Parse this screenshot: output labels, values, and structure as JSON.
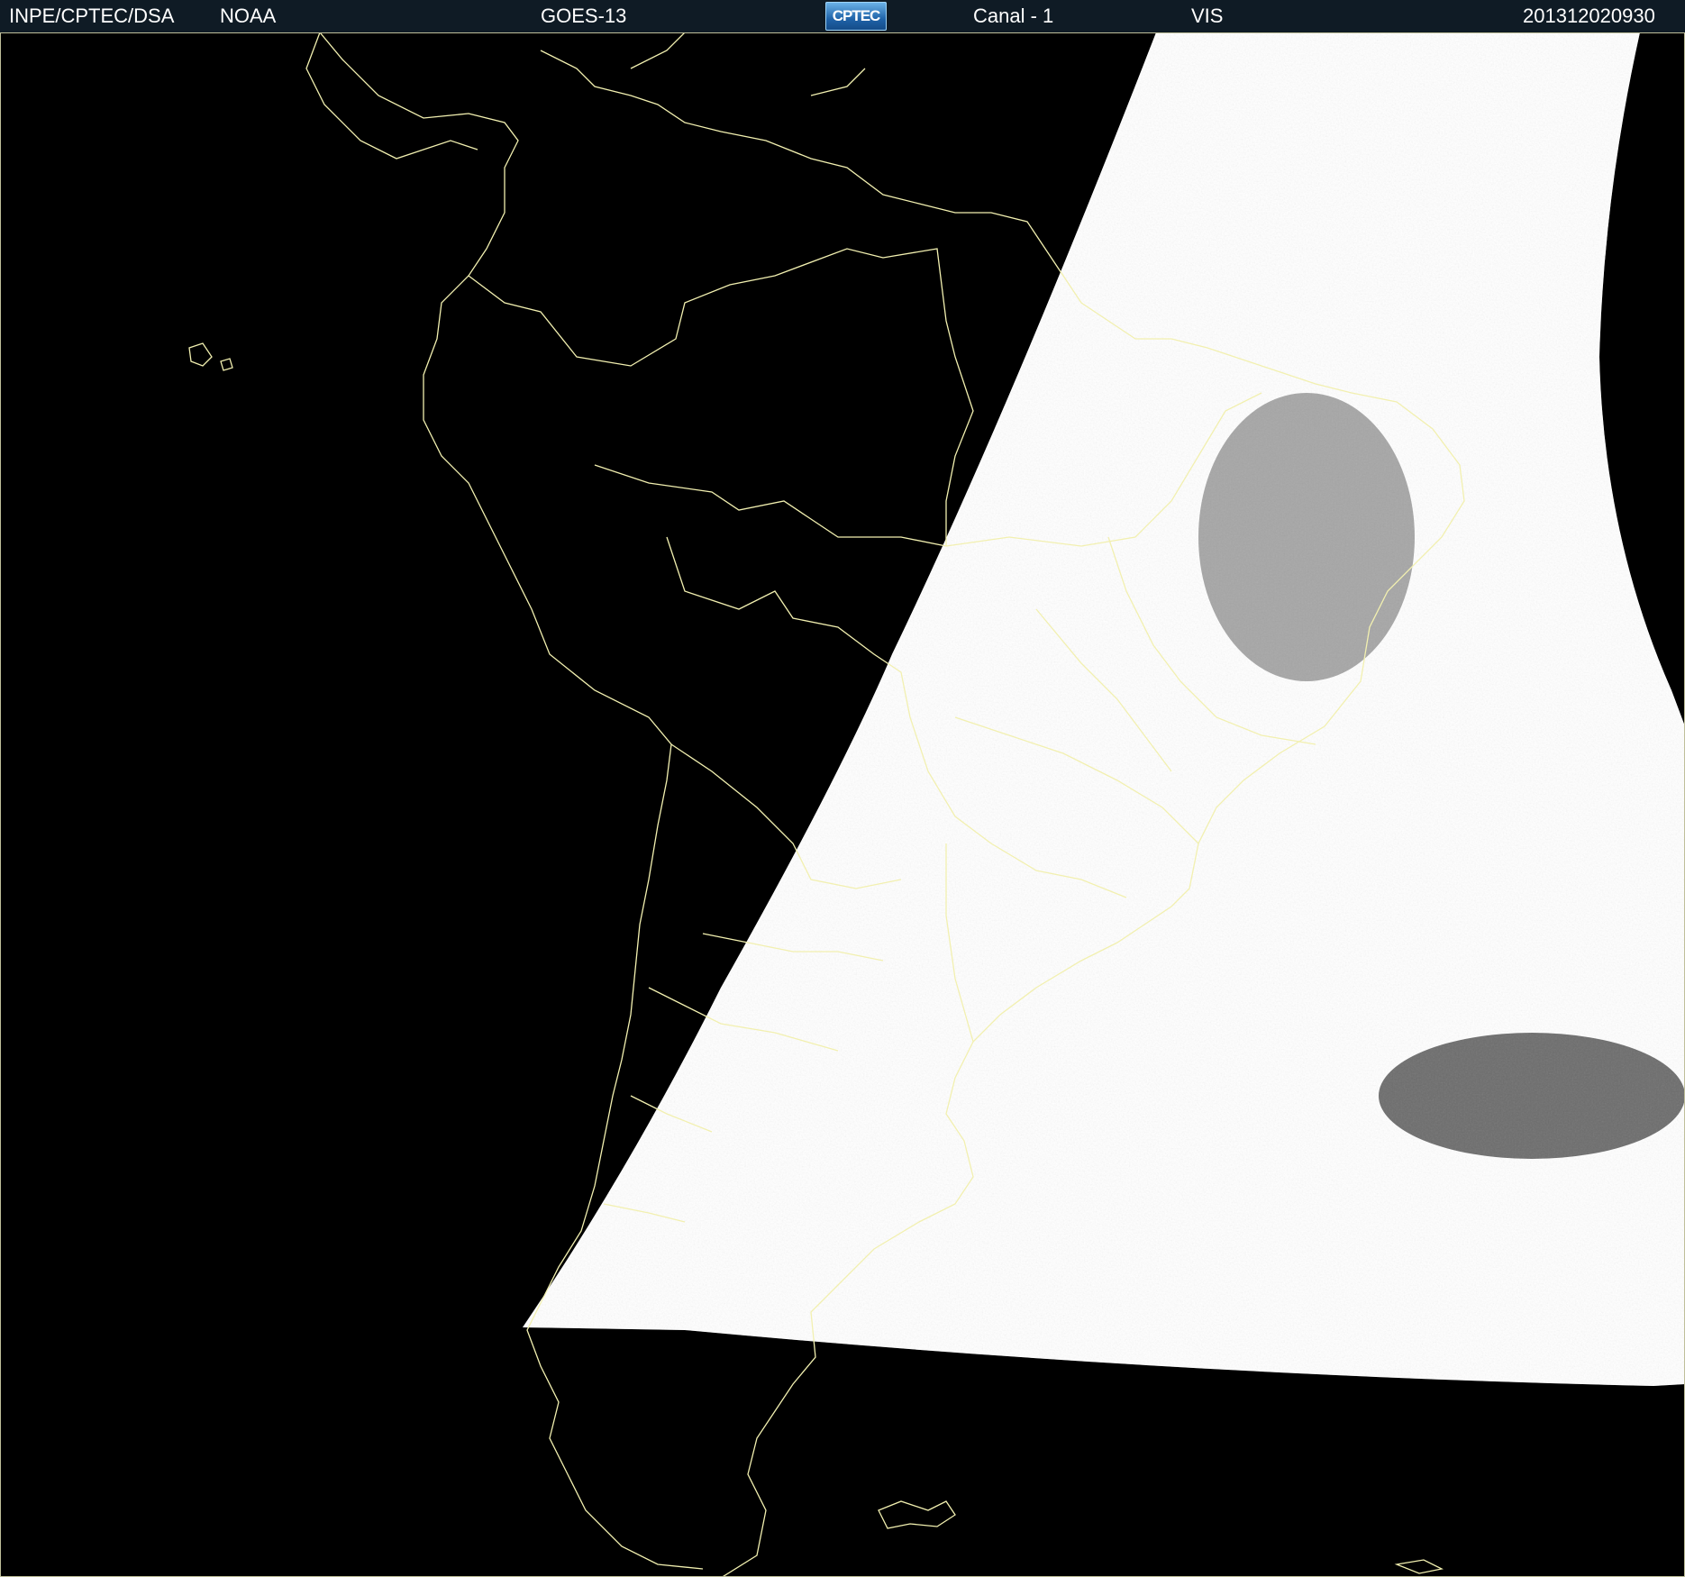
{
  "header": {
    "institution": "INPE/CPTEC/DSA",
    "agency": "NOAA",
    "satellite": "GOES-13",
    "logo_text": "CPTEC",
    "channel": "Canal - 1",
    "band": "VIS",
    "timestamp": "201312020930"
  },
  "colors": {
    "background": "#000000",
    "header_bar": "#0f1b25",
    "coastline": "#f2f0b0",
    "logo_blue": "#1f63a8"
  }
}
